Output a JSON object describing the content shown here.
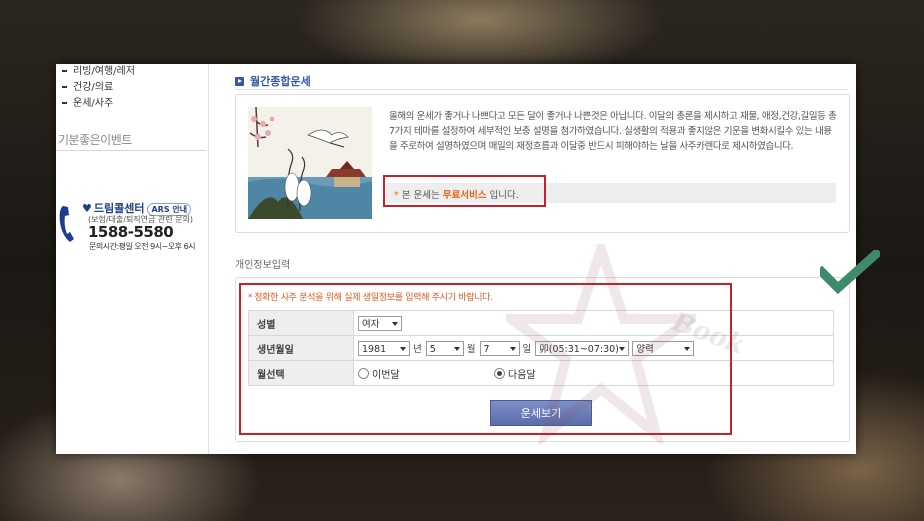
{
  "sidebar": {
    "menu": [
      "리빙/여행/레저",
      "건강/의료",
      "운세/사주"
    ],
    "event_title": "기분좋은이벤트",
    "call_center": {
      "title": "드림콜센터",
      "ars_badge": "ARS 안내",
      "subtitle": "(보험/대출/퇴직연금 관련 문의)",
      "number": "1588-5580",
      "hours": "문의시간:평일 오전 9시~오후 6시"
    }
  },
  "main": {
    "section_title": "월간종합운세",
    "intro": {
      "text": "올해의 운세가 좋거나 나쁘다고 모든 달이 좋거나 나쁜것은 아닙니다. 이달의 총론을 제시하고 재물, 애정,건강,길일등 총 7가지 테마를 설정하여 세부적인 보충 설명을 첨가하였습니다. 실생활의 적용과 좋지않은 기운을 변화시킬수 있는 내용을 주로하여 설명하였으며 매일의 재정흐름과 이달중 반드시 피해야하는 날을 사주카렌다로 제시하였습니다.",
      "free_prefix": "본 운세는",
      "free_highlight": "무료서비스",
      "free_suffix": "입니다."
    },
    "personal_title": "개인정보입력",
    "form": {
      "notice": "정확한 사주 분석을 위해 실제 생일정보를 입력해 주시기 바랍니다.",
      "gender_label": "성별",
      "gender_value": "여자",
      "birth_label": "생년월일",
      "year_value": "1981",
      "year_unit": "년",
      "month_value": "5",
      "month_unit": "월",
      "day_value": "7",
      "day_unit": "일",
      "time_value": "卯(05:31~07:30)",
      "calendar_value": "양력",
      "month_select_label": "월선택",
      "option_this_month": "이번달",
      "option_next_month": "다음달",
      "selected_option": "다음달",
      "submit_label": "운세보기"
    },
    "watermark_text": "Book"
  },
  "colors": {
    "accent_blue": "#3856a6",
    "highlight_orange": "#e0651a",
    "annotation_red": "#c8202a",
    "checkmark_green": "#3f8a6d"
  }
}
